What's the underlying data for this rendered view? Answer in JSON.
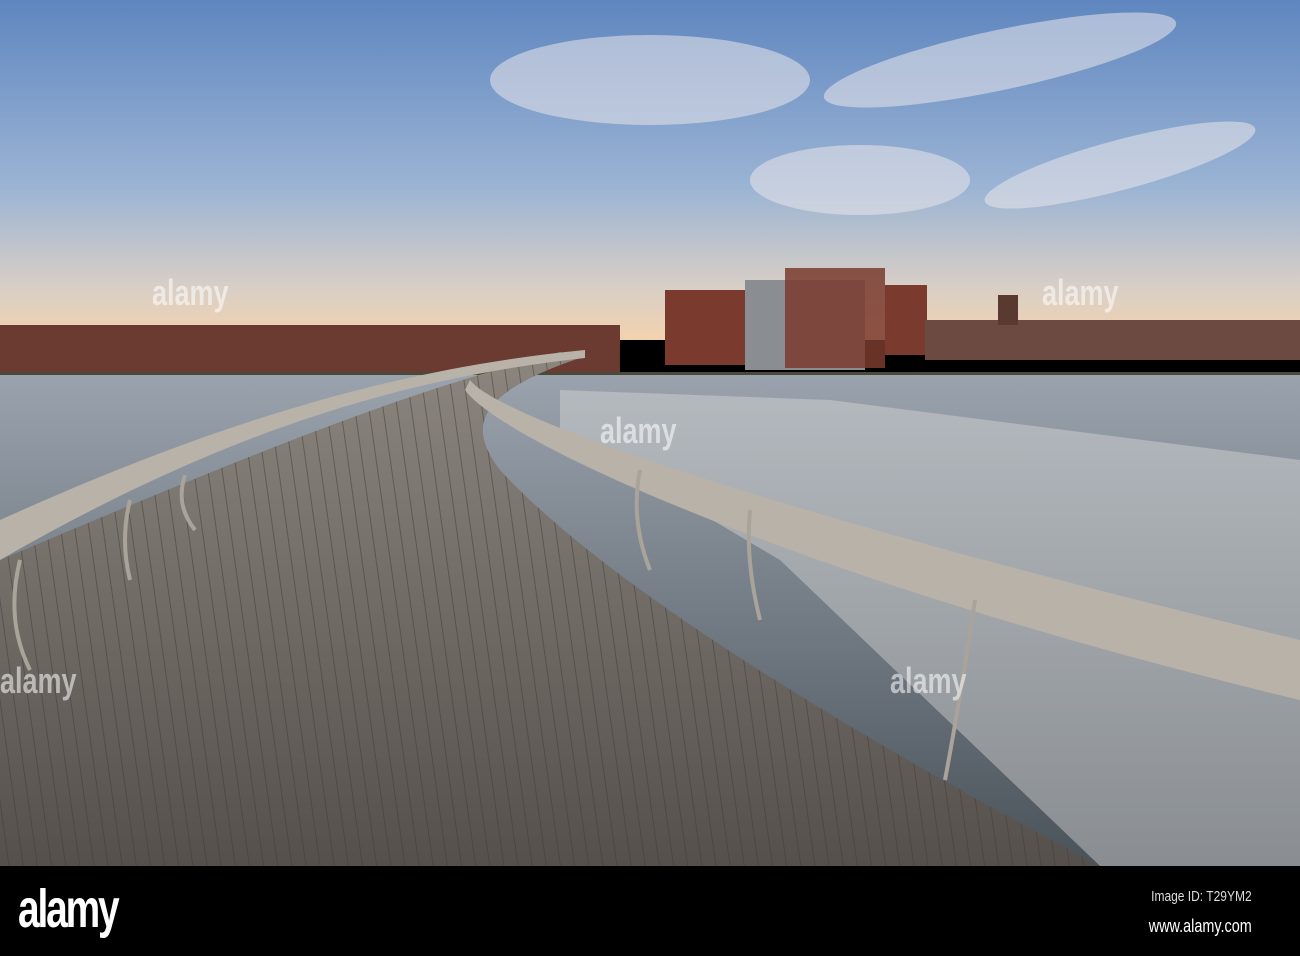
{
  "watermark": {
    "brand": "alamy",
    "image_id": "Image ID: T29YM2",
    "site": "www.alamy.com"
  },
  "colors": {
    "sky_top": "#5f86c0",
    "sky_horizon": "#f2d2ae",
    "water": "#5d6670",
    "deck": "#6b6661",
    "railing": "#b9b2a8",
    "brick": "#7a3b2e"
  }
}
